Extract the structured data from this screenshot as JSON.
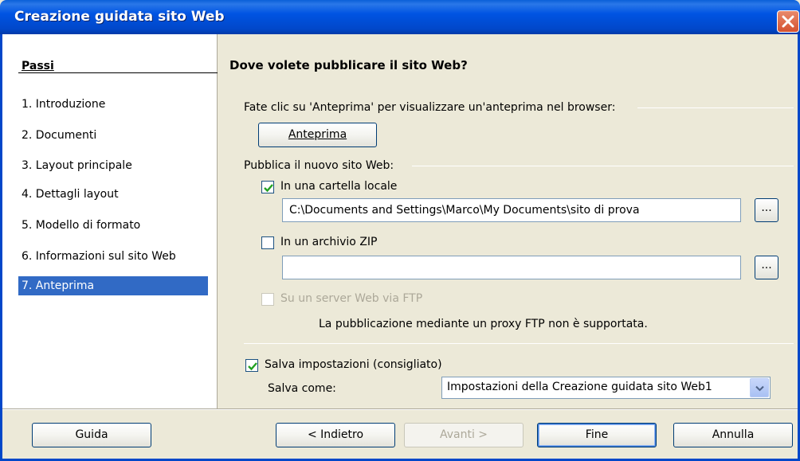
{
  "window": {
    "title": "Creazione guidata sito Web",
    "close_icon": "close-icon"
  },
  "sidebar": {
    "title": "Passi",
    "steps": [
      "1. Introduzione",
      "2. Documenti",
      "3. Layout principale",
      "4. Dettagli layout",
      "5. Modello di formato",
      "6. Informazioni sul sito Web",
      "7. Anteprima"
    ],
    "active_step": 6
  },
  "main": {
    "heading": "Dove volete pubblicare il sito Web?",
    "preview_section_label": "Fate clic su 'Anteprima' per visualizzare un'anteprima nel browser:",
    "preview_button": "Anteprima",
    "publish_section_label": "Pubblica il nuovo sito Web:",
    "local_folder": {
      "label": "In una cartella locale",
      "checked": true,
      "path": "C:\\Documents and Settings\\Marco\\My Documents\\sito di prova",
      "browse_label": "..."
    },
    "zip_archive": {
      "label": "In un archivio ZIP",
      "checked": false,
      "path": "",
      "browse_label": "..."
    },
    "ftp": {
      "label": "Su un server Web via FTP",
      "checked": false,
      "enabled": false,
      "note": "La pubblicazione mediante un proxy FTP non è supportata."
    },
    "save_settings": {
      "label": "Salva impostazioni (consigliato)",
      "checked": true,
      "save_as_label": "Salva come:",
      "save_as_value": "Impostazioni della Creazione guidata sito Web1"
    }
  },
  "footer": {
    "help": "Guida",
    "back": "< Indietro",
    "next": "Avanti >",
    "finish": "Fine",
    "cancel": "Annulla"
  },
  "colors": {
    "title_bar": "#0054e3",
    "selection": "#316ac5",
    "dialog_bg": "#ece9d8",
    "check_green": "#21a121"
  }
}
